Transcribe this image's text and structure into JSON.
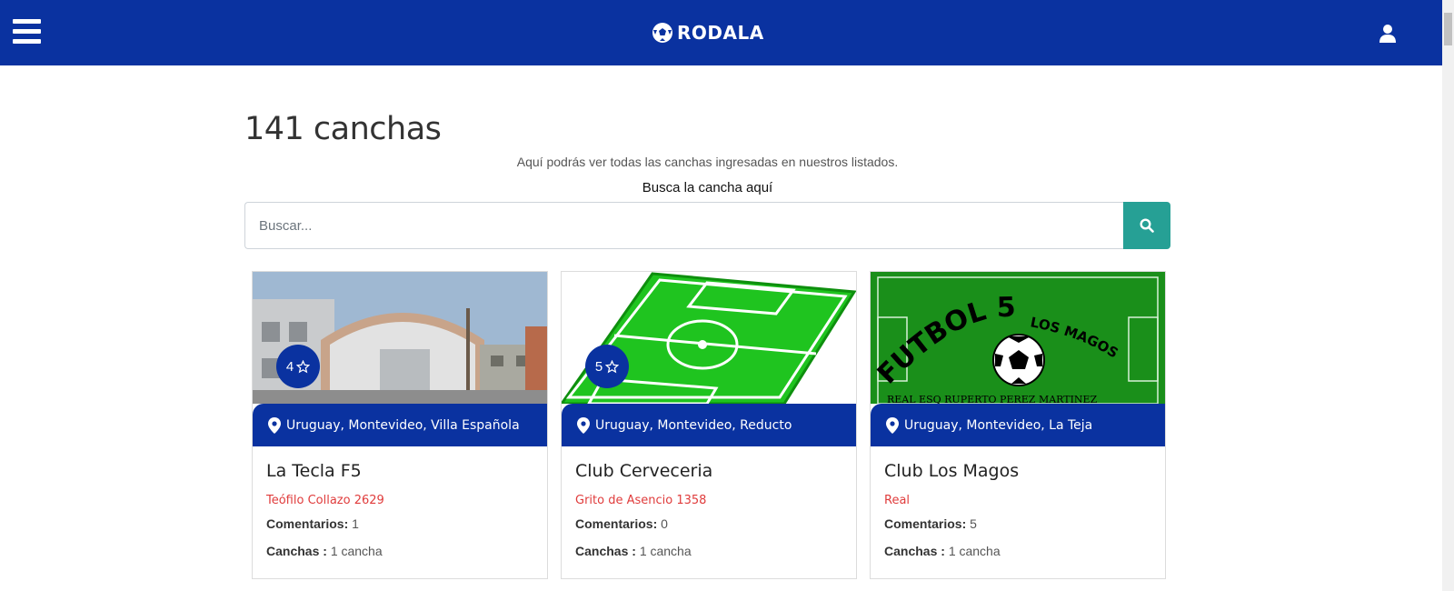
{
  "header": {
    "brand": "RODALA",
    "menu_icon": "hamburger-menu-icon",
    "user_icon": "user-icon",
    "bar_color": "#0a32a0"
  },
  "main": {
    "title": "141 canchas",
    "subtitle": "Aquí podrás ver todas las canchas ingresadas en nuestros listados.",
    "search_label": "Busca la cancha aquí",
    "search_placeholder": "Buscar...",
    "search_icon": "search-icon",
    "search_button_color": "#26a095"
  },
  "cards": [
    {
      "rating": "4",
      "location": "Uruguay, Montevideo, Villa Española",
      "name": "La Tecla F5",
      "address": "Teófilo Collazo 2629",
      "comments_label": "Comentarios:",
      "comments": "1",
      "courts_label": "Canchas :",
      "courts": "1 cancha"
    },
    {
      "rating": "5",
      "location": "Uruguay, Montevideo, Reducto",
      "name": "Club Cerveceria",
      "address": "Grito de Asencio 1358",
      "comments_label": "Comentarios:",
      "comments": "0",
      "courts_label": "Canchas :",
      "courts": "1 cancha"
    },
    {
      "location": "Uruguay, Montevideo, La Teja",
      "name": "Club Los Magos",
      "address": "Real",
      "comments_label": "Comentarios:",
      "comments": "5",
      "courts_label": "Canchas :",
      "courts": "1 cancha",
      "image_text": {
        "line1": "FUTBOL 5",
        "line2": "LOS MAGOS",
        "line3": "REAL ESQ RUPERTO PEREZ MARTINEZ"
      }
    }
  ]
}
